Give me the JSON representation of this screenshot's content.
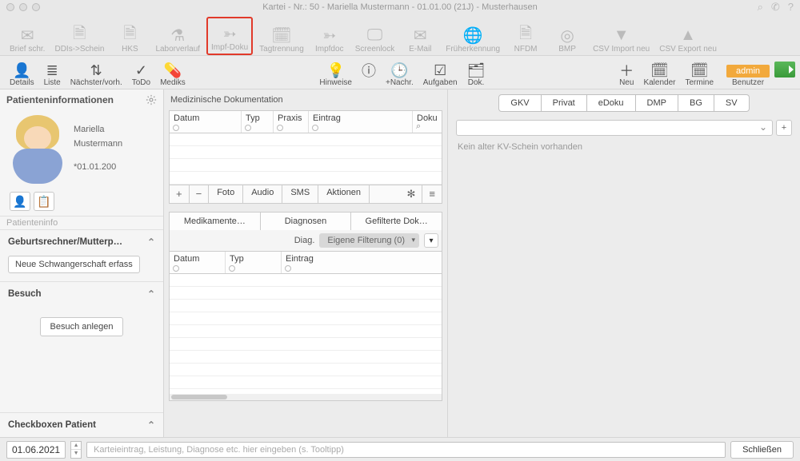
{
  "window": {
    "title": "Kartei - Nr.: 50 - Mariella Mustermann - 01.01.00 (21J) - Musterhausen"
  },
  "toolbar1": [
    {
      "label": "Brief schr.",
      "icon": "mail-plus-icon"
    },
    {
      "label": "DDIs->Schein",
      "icon": "doc-arrow-icon"
    },
    {
      "label": "HKS",
      "icon": "doc-edit-icon"
    },
    {
      "label": "Laborverlauf",
      "icon": "flask-icon"
    },
    {
      "label": "Impf-Doku",
      "icon": "syringe-icon",
      "highlight": true
    },
    {
      "label": "Tagtrennung",
      "icon": "calendar-split-icon"
    },
    {
      "label": "Impfdoc",
      "icon": "syringe-icon"
    },
    {
      "label": "Screenlock",
      "icon": "monitor-lock-icon"
    },
    {
      "label": "E-Mail",
      "icon": "envelope-icon"
    },
    {
      "label": "Früherkennung",
      "icon": "globe-icon"
    },
    {
      "label": "NFDM",
      "icon": "doc-x-icon"
    },
    {
      "label": "BMP",
      "icon": "target-icon"
    },
    {
      "label": "CSV Import neu",
      "icon": "triangle-down-icon"
    },
    {
      "label": "CSV Export neu",
      "icon": "triangle-up-icon"
    }
  ],
  "toolbar2_left": [
    {
      "label": "Details",
      "icon": "person-icon"
    },
    {
      "label": "Liste",
      "icon": "list-icon"
    },
    {
      "label": "Nächster/vorh.",
      "icon": "arrows-icon"
    },
    {
      "label": "ToDo",
      "icon": "check-icon"
    },
    {
      "label": "Mediks",
      "icon": "pill-icon"
    }
  ],
  "toolbar2_center": [
    {
      "label": "Hinweise",
      "icon": "bulb-icon"
    },
    {
      "label": "",
      "icon": "info-icon"
    },
    {
      "label": "+Nachr.",
      "icon": "clock-icon"
    },
    {
      "label": "Aufgaben",
      "icon": "checklist-icon"
    },
    {
      "label": "Dok.",
      "icon": "folder-icon"
    }
  ],
  "toolbar2_right": [
    {
      "label": "Neu",
      "icon": "plus-icon"
    },
    {
      "label": "Kalender",
      "icon": "cal-icon"
    },
    {
      "label": "Termine",
      "icon": "cal2-icon"
    }
  ],
  "admin_button": "admin",
  "benutzer_label": "Benutzer",
  "left": {
    "title": "Patienteninformationen",
    "patient_first": "Mariella",
    "patient_last": "Mustermann",
    "patient_dob": "*01.01.200",
    "patientinfo_label": "Patienteninfo",
    "sections": {
      "geburt": "Geburtsrechner/Mutterp…",
      "neue_schw": "Neue Schwangerschaft erfass",
      "besuch": "Besuch",
      "besuch_btn": "Besuch anlegen",
      "checkbox": "Checkboxen Patient"
    }
  },
  "mid": {
    "title": "Medizinische Dokumentation",
    "cols1": {
      "datum": "Datum",
      "typ": "Typ",
      "praxis": "Praxis",
      "eintrag": "Eintrag",
      "doku": "Doku"
    },
    "bar": {
      "foto": "Foto",
      "audio": "Audio",
      "sms": "SMS",
      "aktionen": "Aktionen"
    },
    "tabs": {
      "med": "Medikamente…",
      "diag": "Diagnosen",
      "gef": "Gefilterte Dok…"
    },
    "filter": {
      "diag": "Diag.",
      "eigene": "Eigene Filterung (0)"
    },
    "cols2": {
      "datum": "Datum",
      "typ": "Typ",
      "eintrag": "Eintrag"
    }
  },
  "right": {
    "tabs": [
      "GKV",
      "Privat",
      "eDoku",
      "DMP",
      "BG",
      "SV"
    ],
    "note": "Kein alter KV-Schein vorhanden"
  },
  "footer": {
    "date": "01.06.2021",
    "placeholder": "Karteieintrag, Leistung, Diagnose etc. hier eingeben (s. Tooltipp)",
    "close": "Schließen"
  }
}
